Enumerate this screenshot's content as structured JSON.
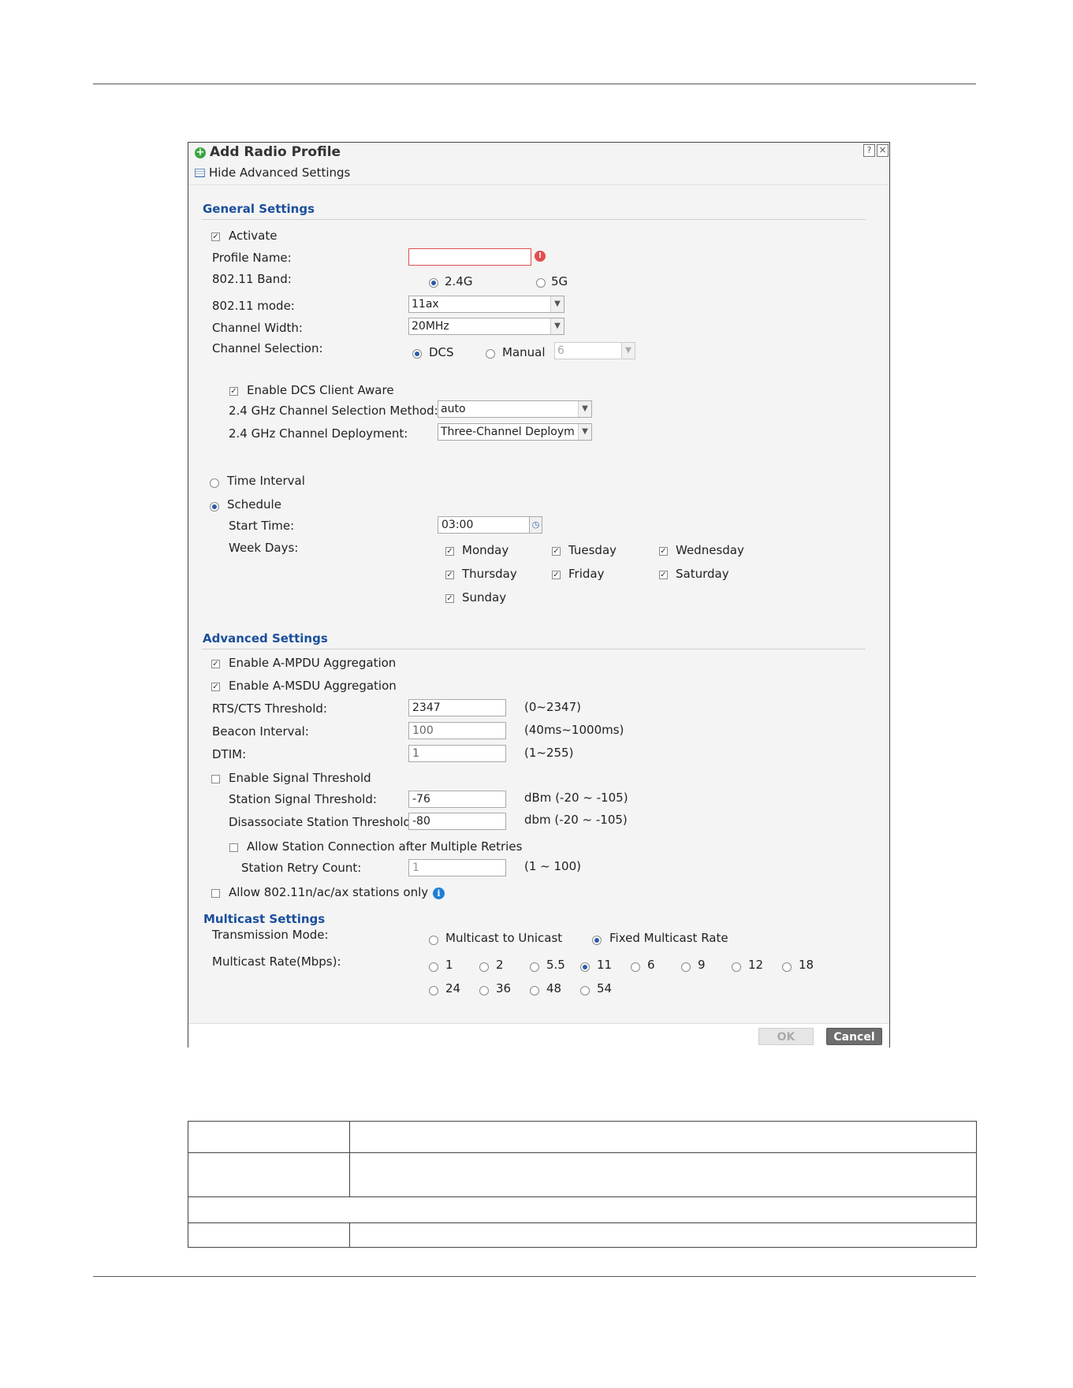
{
  "dialog": {
    "title": "Add Radio Profile",
    "help_icon": "help-icon",
    "close_icon": "close-icon",
    "toggle_advanced": "Hide Advanced Settings"
  },
  "general": {
    "heading": "General Settings",
    "activate": "Activate",
    "profile_name_label": "Profile Name:",
    "profile_name_value": "",
    "band_label": "802.11 Band:",
    "band_24": "2.4G",
    "band_5": "5G",
    "mode_label": "802.11 mode:",
    "mode_value": "11ax",
    "width_label": "Channel Width:",
    "width_value": "20MHz",
    "chsel_label": "Channel Selection:",
    "dcs": "DCS",
    "manual": "Manual",
    "manual_channel": "6",
    "dcs_client_aware": "Enable DCS Client Aware",
    "method_label": "2.4 GHz Channel Selection Method:",
    "method_value": "auto",
    "deploy_label": "2.4 GHz Channel Deployment:",
    "deploy_value": "Three-Channel Deploym",
    "time_interval": "Time Interval",
    "schedule": "Schedule",
    "start_label": "Start Time:",
    "start_value": "03:00",
    "week_label": "Week Days:",
    "days": [
      "Monday",
      "Tuesday",
      "Wednesday",
      "Thursday",
      "Friday",
      "Saturday",
      "Sunday"
    ]
  },
  "advanced": {
    "heading": "Advanced Settings",
    "ampdu": "Enable A-MPDU Aggregation",
    "amsdu": "Enable A-MSDU Aggregation",
    "rts_label": "RTS/CTS Threshold:",
    "rts_value": "2347",
    "rts_range": "(0~2347)",
    "beacon_label": "Beacon Interval:",
    "beacon_value": "100",
    "beacon_range": "(40ms~1000ms)",
    "dtim_label": "DTIM:",
    "dtim_value": "1",
    "dtim_range": "(1~255)",
    "signal_threshold": "Enable Signal Threshold",
    "station_signal_label": "Station Signal Threshold:",
    "station_signal_value": "-76",
    "station_signal_range": "dBm (-20 ~ -105)",
    "disassoc_label": "Disassociate Station Threshold:",
    "disassoc_value": "-80",
    "disassoc_range": "dbm (-20 ~ -105)",
    "allow_retry": "Allow Station Connection after Multiple Retries",
    "retry_label": "Station Retry Count:",
    "retry_value": "1",
    "retry_range": "(1 ~ 100)",
    "n_only": "Allow 802.11n/ac/ax stations only"
  },
  "multicast": {
    "heading": "Multicast Settings",
    "tx_label": "Transmission Mode:",
    "to_unicast": "Multicast to Unicast",
    "fixed_rate": "Fixed Multicast Rate",
    "rate_label": "Multicast Rate(Mbps):",
    "rates": [
      "1",
      "2",
      "5.5",
      "11",
      "6",
      "9",
      "12",
      "18",
      "24",
      "36",
      "48",
      "54"
    ],
    "selected_rate": "11"
  },
  "buttons": {
    "ok": "OK",
    "cancel": "Cancel"
  },
  "colors": {
    "heading": "#1a4f9c",
    "error_border": "#e05050",
    "info": "#1e7fd8",
    "cancel_bg": "#6e6e6e"
  }
}
